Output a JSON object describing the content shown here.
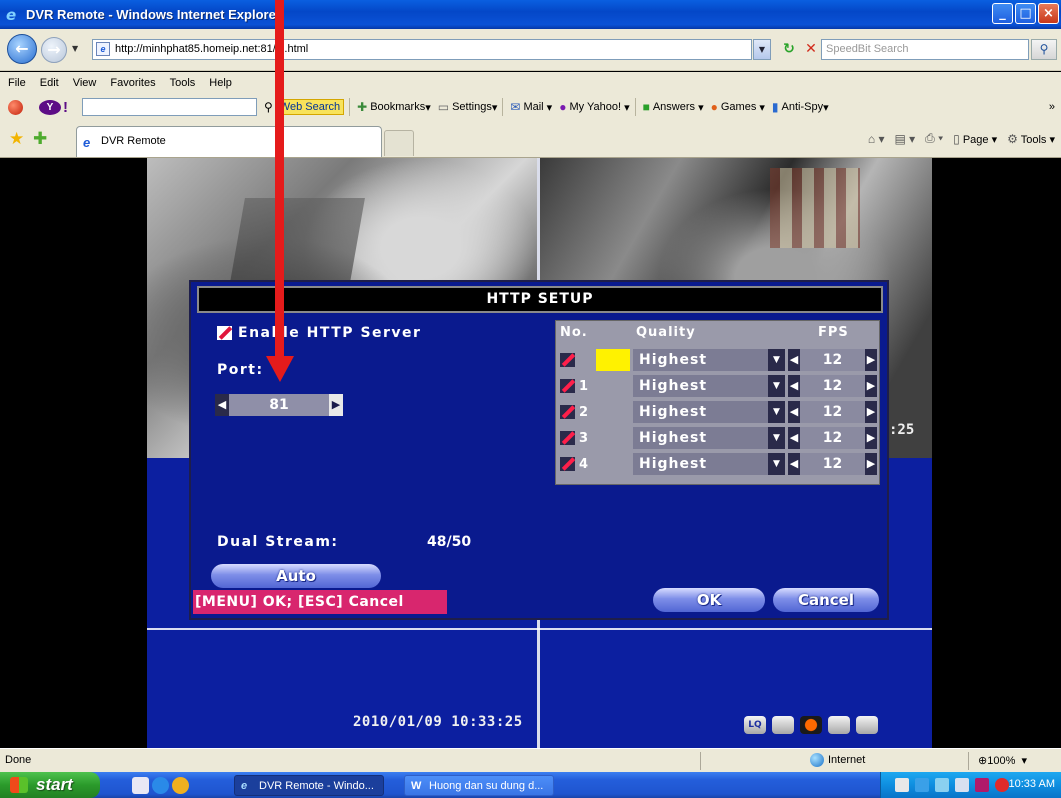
{
  "window": {
    "title": "DVR Remote - Windows Internet Explorer",
    "controls": [
      "_",
      "□",
      "×"
    ]
  },
  "address_bar": {
    "url": "http://minhphat85.homeip.net:81/ie.html",
    "search_placeholder": "SpeedBit Search"
  },
  "menu": [
    "File",
    "Edit",
    "View",
    "Favorites",
    "Tools",
    "Help"
  ],
  "yahoo_toolbar": {
    "web_search": "Web Search",
    "items": [
      "Bookmarks",
      "Settings",
      "Mail",
      "My Yahoo!",
      "Answers",
      "Games",
      "Anti-Spy"
    ],
    "more": "»"
  },
  "tabs": {
    "active_label": "DVR Remote"
  },
  "command_bar": {
    "page": "Page",
    "tools": "Tools"
  },
  "dvr": {
    "dialog_title": "HTTP SETUP",
    "enable_label": "Enable HTTP Server",
    "enable_checked": true,
    "port_label": "Port:",
    "port_value": "81",
    "grid_headers": {
      "no": "No.",
      "quality": "Quality",
      "fps": "FPS"
    },
    "streams": [
      {
        "no": "",
        "quality": "Highest",
        "fps": "12",
        "selected": true
      },
      {
        "no": "1",
        "quality": "Highest",
        "fps": "12"
      },
      {
        "no": "2",
        "quality": "Highest",
        "fps": "12"
      },
      {
        "no": "3",
        "quality": "Highest",
        "fps": "12"
      },
      {
        "no": "4",
        "quality": "Highest",
        "fps": "12"
      }
    ],
    "dual_stream_label": "Dual Stream:",
    "dual_stream_value": "48/50",
    "auto_button": "Auto",
    "menu_hint": "[MENU] OK; [ESC] Cancel",
    "ok_button": "OK",
    "cancel_button": "Cancel",
    "timestamp": "2010/01/09  10:33:25",
    "time_peek": ":25",
    "status_icons": [
      "LQ",
      "",
      "",
      "",
      ""
    ]
  },
  "status_bar": {
    "status": "Done",
    "zone": "Internet",
    "zoom": "100%"
  },
  "taskbar": {
    "start": "start",
    "tasks": [
      "DVR Remote - Windo...",
      "Huong dan su dung d..."
    ],
    "clock": "10:33 AM"
  },
  "colors": {
    "xp_blue": "#0447c8",
    "dvr_blue": "#0a1a8e",
    "annotation_red": "#e51b1b",
    "highlight_yellow": "#fff200",
    "hint_pink": "#d8266e"
  }
}
